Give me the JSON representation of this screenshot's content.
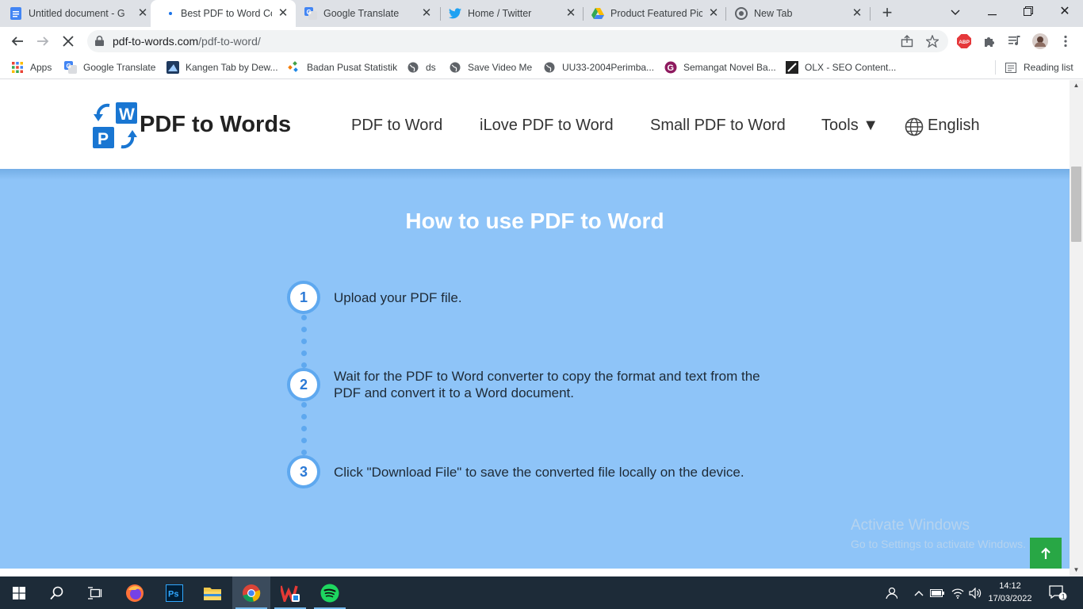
{
  "tabs": [
    {
      "title": "Untitled document - G",
      "icon": "google-docs-icon",
      "active": false
    },
    {
      "title": "Best PDF to Word Con",
      "icon": "loading-dot-icon",
      "active": true
    },
    {
      "title": "Google Translate",
      "icon": "google-translate-icon",
      "active": false
    },
    {
      "title": "Home / Twitter",
      "icon": "twitter-icon",
      "active": false
    },
    {
      "title": "Product Featured Pictu",
      "icon": "google-drive-icon",
      "active": false
    },
    {
      "title": "New Tab",
      "icon": "chrome-icon",
      "active": false
    }
  ],
  "address_bar": {
    "domain": "pdf-to-words.com",
    "path": "/pdf-to-word/"
  },
  "bookmarks": [
    {
      "label": "Apps",
      "icon": "apps-grid-icon"
    },
    {
      "label": "Google Translate",
      "icon": "google-translate-icon"
    },
    {
      "label": "Kangen Tab by Dew...",
      "icon": "kangen-tab-icon"
    },
    {
      "label": "Badan Pusat Statistik",
      "icon": "bps-icon"
    },
    {
      "label": "ds",
      "icon": "globe-icon"
    },
    {
      "label": "Save Video Me",
      "icon": "globe-icon"
    },
    {
      "label": "UU33-2004Perimba...",
      "icon": "globe-icon"
    },
    {
      "label": "Semangat Novel Ba...",
      "icon": "semangat-icon"
    },
    {
      "label": "OLX - SEO Content...",
      "icon": "olx-icon"
    }
  ],
  "reading_list": "Reading list",
  "site": {
    "logo_text": "PDF to Words",
    "logo_letters": {
      "w": "W",
      "p": "P"
    },
    "nav": [
      "PDF to Word",
      "iLove PDF to Word",
      "Small PDF to Word",
      "Tools ▼",
      "English"
    ]
  },
  "howto": {
    "title": "How to use PDF to Word",
    "steps": [
      {
        "number": "1",
        "text": "Upload your PDF file."
      },
      {
        "number": "2",
        "text": "Wait for the PDF to Word converter to copy the format and text from the PDF and convert it to a Word document."
      },
      {
        "number": "3",
        "text": "Click \"Download File\" to save the converted file locally on the device."
      }
    ]
  },
  "watermark": {
    "line1": "Activate Windows",
    "line2": "Go to Settings to activate Windows."
  },
  "taskbar": {
    "time": "14:12",
    "date": "17/03/2022",
    "notification_count": "1",
    "apps": [
      "windows-start-icon",
      "search-icon",
      "task-view-icon",
      "firefox-icon",
      "photoshop-icon",
      "file-explorer-icon",
      "chrome-icon",
      "wps-office-icon",
      "spotify-icon"
    ]
  },
  "colors": {
    "hero": "#8ec4f8",
    "accent": "#5ea8ef",
    "scroll_top": "#28a745",
    "taskbar": "#1d2b38"
  }
}
